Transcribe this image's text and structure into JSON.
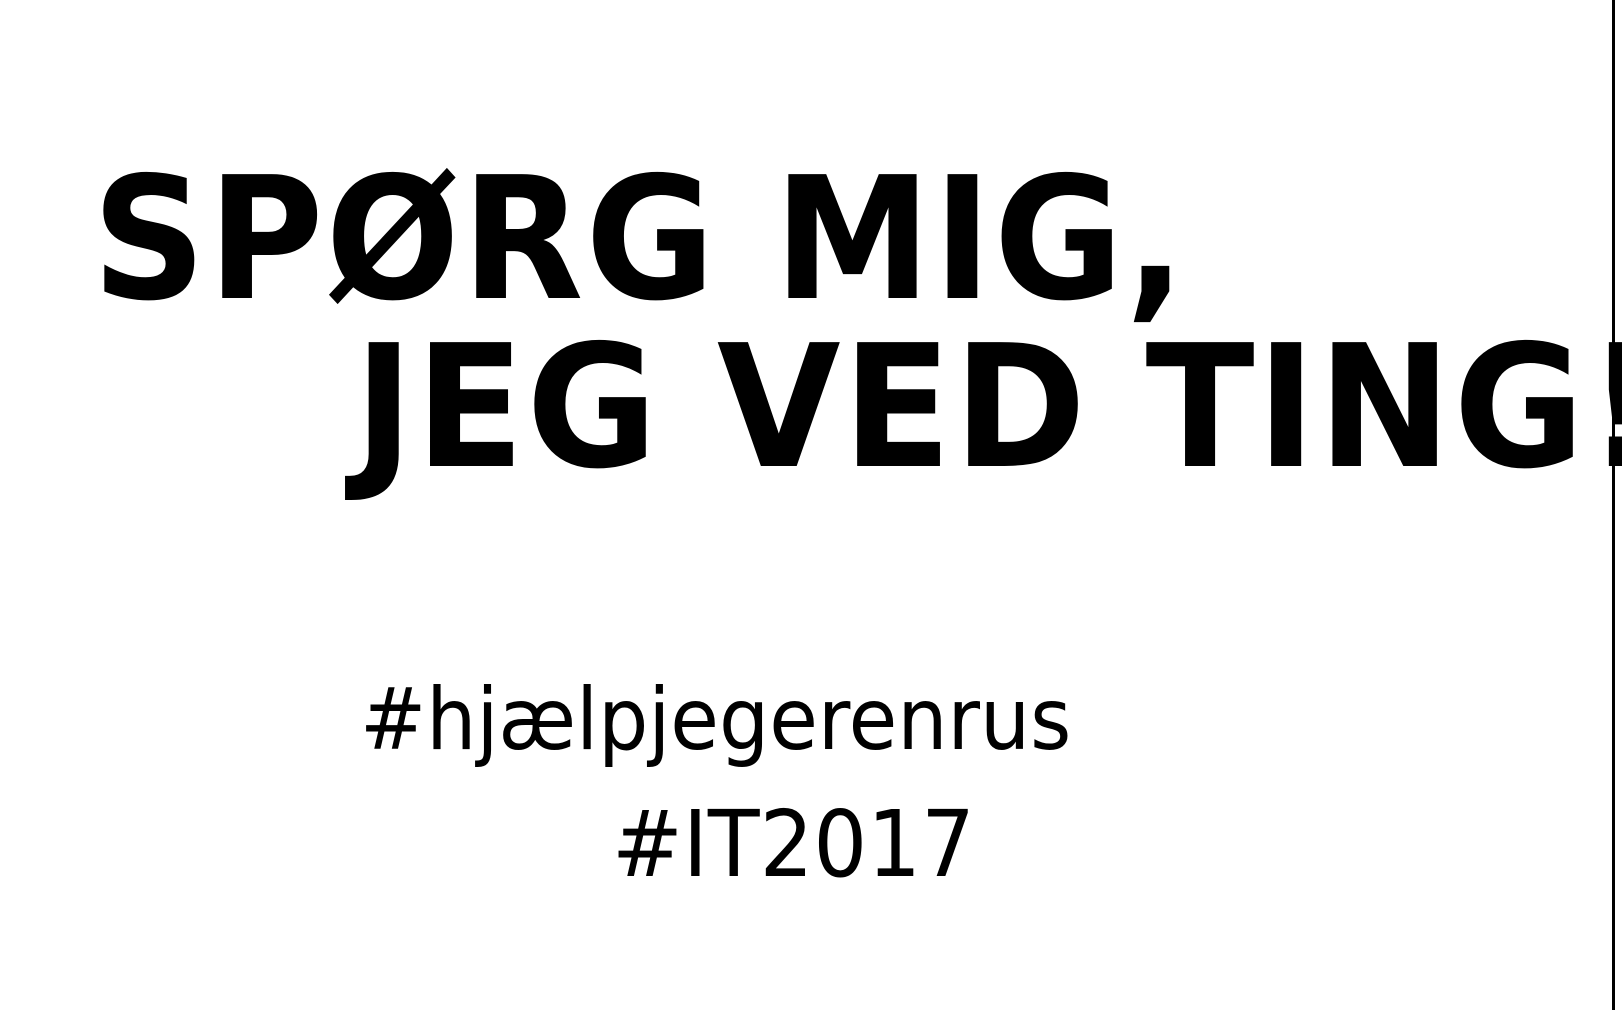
{
  "poster": {
    "headline_line1": "SPØRG MIG,",
    "headline_line2": "JEG VED TING!",
    "hashtag1": "#hjælpjegerenrus",
    "hashtag2": "#IT2017"
  },
  "colors": {
    "background": "#ffffff",
    "text": "#000000"
  }
}
